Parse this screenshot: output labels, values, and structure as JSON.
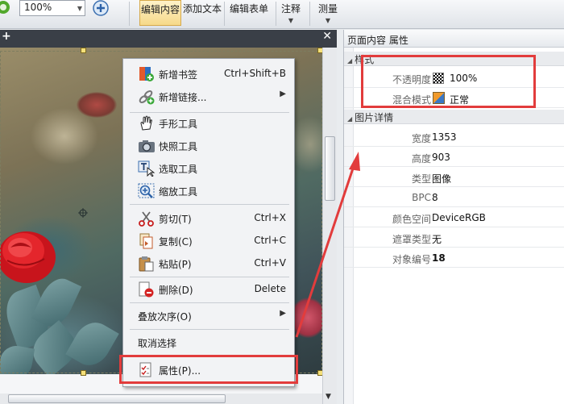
{
  "toolbar": {
    "zoom_value": "100%",
    "buttons": [
      {
        "label": "编辑内容",
        "active": true
      },
      {
        "label": "添加文本",
        "active": false
      },
      {
        "label": "编辑表单",
        "active": false
      },
      {
        "label": "注释",
        "active": false
      },
      {
        "label": "测量",
        "active": false
      }
    ]
  },
  "context_menu": {
    "items": [
      {
        "label": "新增书签",
        "shortcut": "Ctrl+Shift+B",
        "icon": "bookmark-add-icon"
      },
      {
        "label": "新增链接...",
        "shortcut": "",
        "submenu": true,
        "icon": "link-add-icon"
      },
      {
        "label": "手形工具",
        "shortcut": "",
        "icon": "hand-icon"
      },
      {
        "label": "快照工具",
        "shortcut": "",
        "icon": "camera-icon"
      },
      {
        "label": "选取工具",
        "shortcut": "",
        "icon": "text-select-icon"
      },
      {
        "label": "缩放工具",
        "shortcut": "",
        "icon": "zoom-icon"
      },
      {
        "label": "剪切(T)",
        "shortcut": "Ctrl+X",
        "icon": "scissors-icon"
      },
      {
        "label": "复制(C)",
        "shortcut": "Ctrl+C",
        "icon": "copy-icon"
      },
      {
        "label": "粘贴(P)",
        "shortcut": "Ctrl+V",
        "icon": "paste-icon"
      },
      {
        "label": "删除(D)",
        "shortcut": "Delete",
        "icon": "delete-icon"
      },
      {
        "label": "叠放次序(O)",
        "shortcut": "",
        "submenu": true
      },
      {
        "label": "取消选择",
        "shortcut": ""
      },
      {
        "label": "属性(P)...",
        "shortcut": "",
        "icon": "properties-icon"
      }
    ]
  },
  "properties_panel": {
    "title": "页面内容 属性",
    "style_section": {
      "header": "样式",
      "rows": [
        {
          "key": "不透明度",
          "value": "100%"
        },
        {
          "key": "混合模式",
          "value": "正常"
        }
      ]
    },
    "image_section": {
      "header": "图片详情",
      "rows": [
        {
          "key": "宽度",
          "value": "1353"
        },
        {
          "key": "高度",
          "value": "903"
        },
        {
          "key": "类型",
          "value": "图像"
        },
        {
          "key": "BPC",
          "value": "8"
        },
        {
          "key": "颜色空间",
          "value": "DeviceRGB"
        },
        {
          "key": "遮罩类型",
          "value": "无"
        },
        {
          "key": "对象编号",
          "value": "18"
        }
      ]
    }
  },
  "colors": {
    "highlight": "#e23c3c",
    "active_tab": "#f6d98a"
  }
}
